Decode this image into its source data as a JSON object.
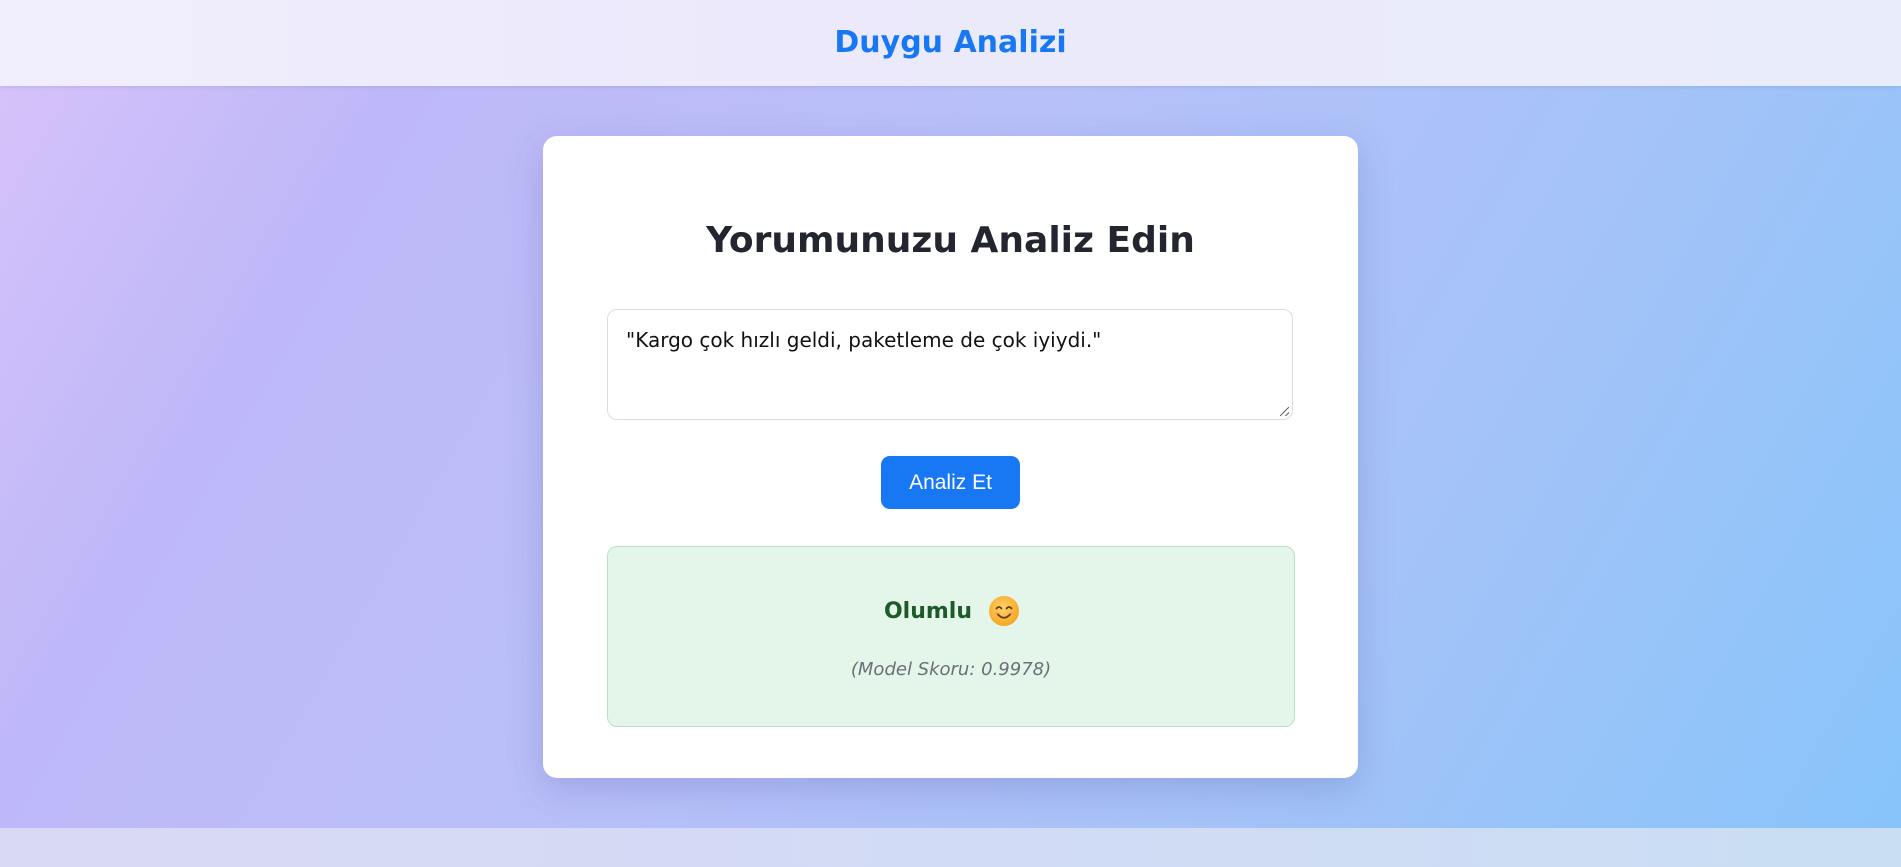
{
  "header": {
    "title": "Duygu Analizi"
  },
  "card": {
    "title": "Yorumunuzu Analiz Edin",
    "comment_text": "\"Kargo çok hızlı geldi, paketleme de çok iyiydi.\"",
    "analyze_button_label": "Analiz Et"
  },
  "result": {
    "label": "Olumlu",
    "icon": "smiling-face-icon",
    "score_text": "(Model Skoru: 0.9978)",
    "score": 0.9978,
    "colors": {
      "background": "#e4f6ea",
      "border": "#b6e2c3",
      "label": "#1c5a2a"
    }
  },
  "colors": {
    "accent": "#1877f2"
  }
}
